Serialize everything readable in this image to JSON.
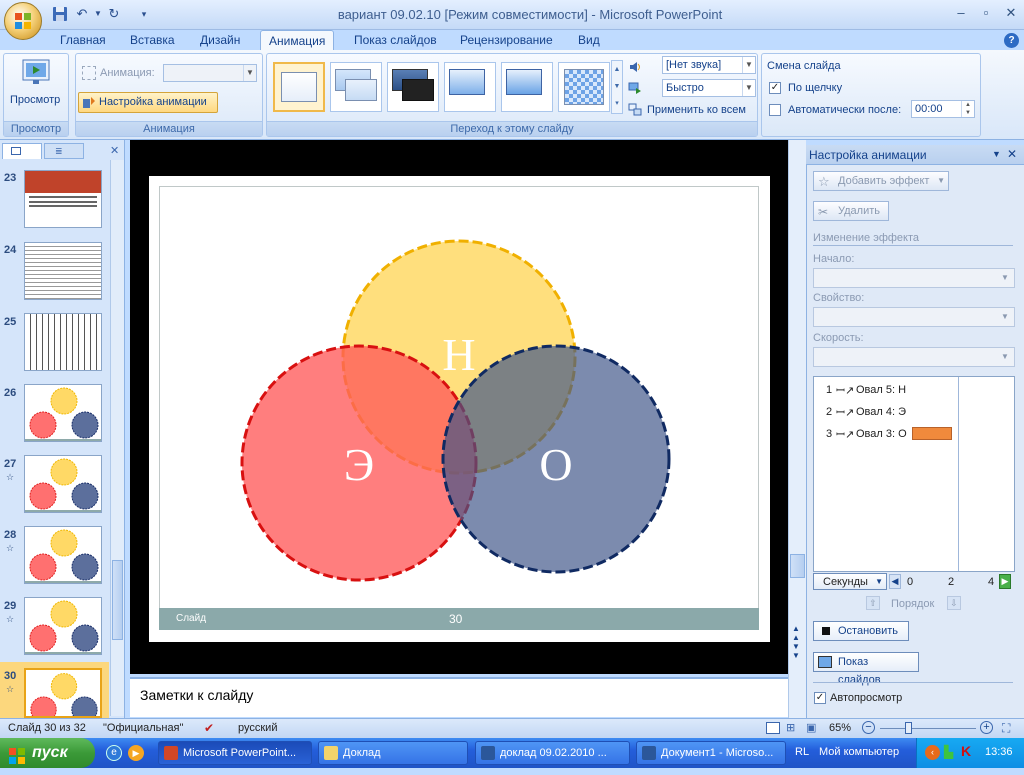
{
  "window": {
    "title": "вариант 09.02.10 [Режим совместимости] - Microsoft PowerPoint",
    "help": "?"
  },
  "tabs": [
    "Главная",
    "Вставка",
    "Дизайн",
    "Анимация",
    "Показ слайдов",
    "Рецензирование",
    "Вид"
  ],
  "ribbon": {
    "preview": {
      "label": "Просмотр",
      "group": "Просмотр"
    },
    "animation": {
      "animation_label": "Анимация:",
      "custom_button": "Настройка анимации",
      "group": "Анимация"
    },
    "transition": {
      "sound": "[Нет звука]",
      "speed": "Быстро",
      "apply_all": "Применить ко всем",
      "group": "Переход к этому слайду"
    },
    "advance": {
      "title": "Смена слайда",
      "on_click": "По щелчку",
      "on_click_checked": true,
      "auto_after": "Автоматически после:",
      "auto_checked": false,
      "time": "00:00"
    }
  },
  "slides_panel": {
    "numbers": [
      "23",
      "24",
      "25",
      "26",
      "27",
      "28",
      "29",
      "30"
    ],
    "current": "30"
  },
  "slide": {
    "labels": {
      "top": "Н",
      "left": "Э",
      "right": "О"
    },
    "footer_label": "Слайд",
    "footer_number": "30",
    "colors": {
      "top": "#ffd966",
      "left": "#ff7070",
      "right": "#5c6f9c"
    }
  },
  "notes": {
    "placeholder": "Заметки к слайду"
  },
  "task_pane": {
    "title": "Настройка анимации",
    "add_effect": "Добавить эффект",
    "remove": "Удалить",
    "modify_header": "Изменение эффекта",
    "start_label": "Начало:",
    "property_label": "Свойство:",
    "speed_label": "Скорость:",
    "effects": [
      {
        "num": "1",
        "name": "Овал 5: Н"
      },
      {
        "num": "2",
        "name": "Овал 4: Э"
      },
      {
        "num": "3",
        "name": "Овал 3: О"
      }
    ],
    "timeline": {
      "unit": "Секунды",
      "ticks": [
        "0",
        "2",
        "4"
      ]
    },
    "order": "Порядок",
    "stop": "Остановить",
    "slideshow": "Показ слайдов",
    "autopreview": "Автопросмотр"
  },
  "status": {
    "slide_info": "Слайд 30 из 32",
    "theme": "\"Официальная\"",
    "language": "русский",
    "zoom": "65%"
  },
  "taskbar": {
    "start": "пуск",
    "items": [
      "Microsoft PowerPoint...",
      "Доклад",
      "доклад 09.02.2010 ...",
      "Документ1 - Microso..."
    ],
    "tray_text": "Мой компьютер",
    "tray_prefix": "RL",
    "clock": "13:36"
  }
}
